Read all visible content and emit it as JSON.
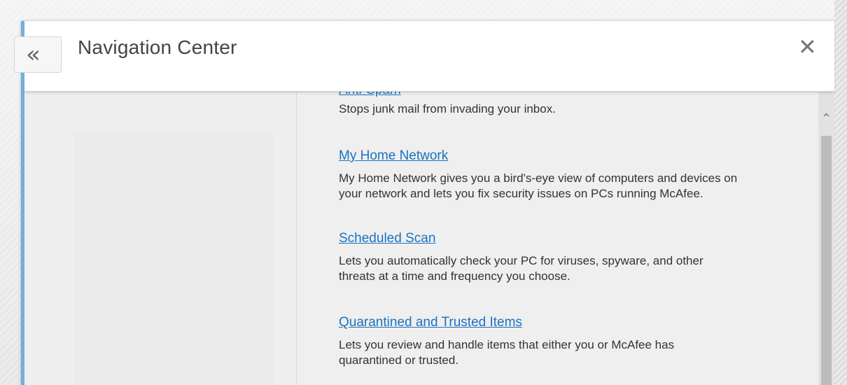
{
  "header": {
    "title": "Navigation Center",
    "back_icon": "double-chevron-left-icon",
    "close_icon": "close-icon"
  },
  "features": [
    {
      "title": "Anti-Spam",
      "description": "Stops junk mail from invading your inbox."
    },
    {
      "title": "My Home Network",
      "description_lines": [
        "My Home Network gives you a bird's-eye view of computers and devices on",
        "your network and lets you fix security issues on PCs running McAfee."
      ]
    },
    {
      "title": "Scheduled Scan",
      "description_lines": [
        "Lets you automatically check your PC for viruses, spyware, and other",
        "threats at a time and frequency you choose."
      ]
    },
    {
      "title": "Quarantined and Trusted Items",
      "description_lines": [
        "Lets you review and handle items that either you or McAfee has",
        "quarantined or trusted."
      ]
    }
  ],
  "colors": {
    "link": "#1b72c2",
    "accent_border": "#6fb0dc"
  }
}
